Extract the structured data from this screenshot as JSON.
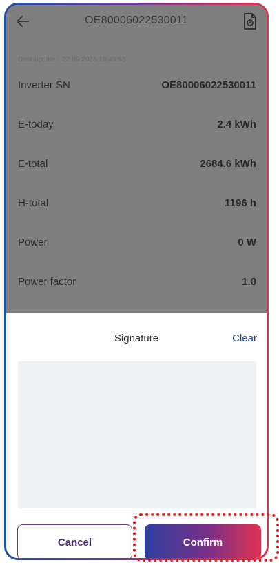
{
  "header": {
    "title": "OE80006022530011",
    "back_icon": "arrow-left-icon",
    "doc_icon": "document-sign-icon"
  },
  "data_update": "Data update：22.09.2025,19:49:53",
  "rows": [
    {
      "label": "Inverter SN",
      "value": "OE80006022530011"
    },
    {
      "label": "E-today",
      "value": "2.4 kWh"
    },
    {
      "label": "E-total",
      "value": "2684.6 kWh"
    },
    {
      "label": "H-total",
      "value": "1196 h"
    },
    {
      "label": "Power",
      "value": "0 W"
    },
    {
      "label": "Power factor",
      "value": "1.0"
    }
  ],
  "sheet": {
    "title": "Signature",
    "clear_label": "Clear",
    "cancel_label": "Cancel",
    "confirm_label": "Confirm"
  },
  "colors": {
    "accent_blue": "#24489a",
    "gradient_start": "#2e3f9e",
    "gradient_end": "#e03350",
    "highlight": "#e21b1b"
  }
}
